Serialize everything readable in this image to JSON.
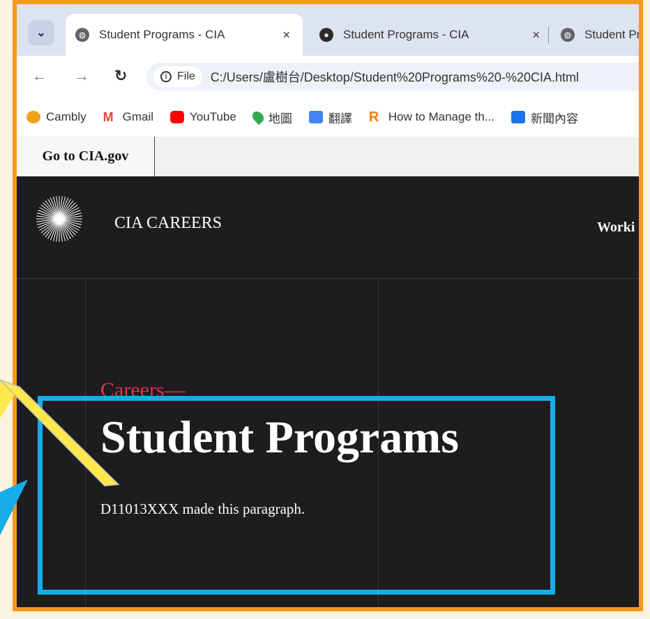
{
  "browser": {
    "tab_dropdown_icon": "chevron-down-icon",
    "tabs": [
      {
        "title": "Student Programs - CIA",
        "favicon": "globe-icon"
      },
      {
        "title": "Student Programs - CIA",
        "favicon": "cia-seal-icon"
      },
      {
        "title": "Student Pr",
        "favicon": "globe-icon"
      }
    ],
    "close_glyph": "×",
    "address": {
      "chip_label": "File",
      "url": "C:/Users/盧樹台/Desktop/Student%20Programs%20-%20CIA.html"
    },
    "bookmarks": [
      {
        "label": "Cambly",
        "color": "#f0a21a"
      },
      {
        "label": "Gmail",
        "color": "#ea4335"
      },
      {
        "label": "YouTube",
        "color": "#ff0000"
      },
      {
        "label": "地圖",
        "color": "#34a853"
      },
      {
        "label": "翻譯",
        "color": "#4285f4"
      },
      {
        "label": "How to Manage th...",
        "color": "#f57c00"
      },
      {
        "label": "新聞內容",
        "color": "#1a73e8"
      }
    ]
  },
  "site": {
    "gov_link": "Go to CIA.gov",
    "brand": "CIA CAREERS",
    "nav_item": "Worki",
    "eyebrow": "Careers—",
    "title": "Student Programs",
    "paragraph": "D11013XXX made this paragraph."
  },
  "colors": {
    "frame": "#f7991c",
    "highlight": "#16aee8",
    "eyebrow": "#e0334a"
  }
}
